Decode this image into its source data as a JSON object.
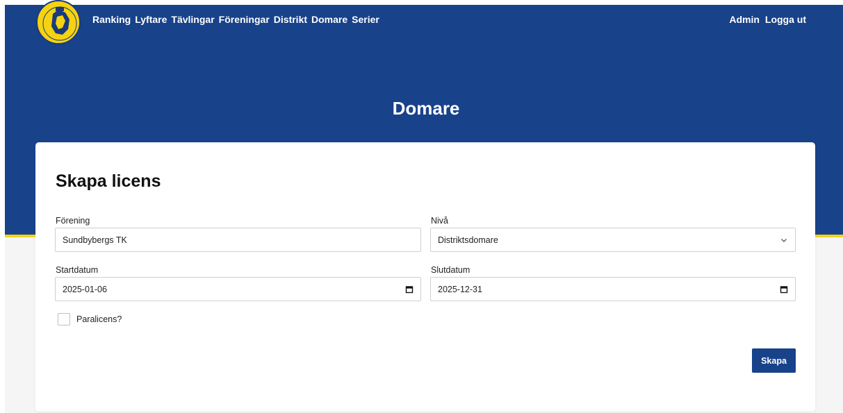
{
  "nav": {
    "items": [
      {
        "label": "Ranking"
      },
      {
        "label": "Lyftare"
      },
      {
        "label": "Tävlingar"
      },
      {
        "label": "Föreningar"
      },
      {
        "label": "Distrikt"
      },
      {
        "label": "Domare"
      },
      {
        "label": "Serier"
      }
    ],
    "admin": "Admin",
    "logout": "Logga ut"
  },
  "page": {
    "title": "Domare"
  },
  "form": {
    "title": "Skapa licens",
    "club": {
      "label": "Förening",
      "value": "Sundbybergs TK"
    },
    "level": {
      "label": "Nivå",
      "value": "Distriktsdomare"
    },
    "start": {
      "label": "Startdatum",
      "value": "2025-01-06"
    },
    "end": {
      "label": "Slutdatum",
      "value": "2025-12-31"
    },
    "para": {
      "label": "Paralicens?",
      "checked": false
    },
    "submit_label": "Skapa"
  },
  "colors": {
    "brand": "#18428a",
    "accent": "#f7d417"
  }
}
